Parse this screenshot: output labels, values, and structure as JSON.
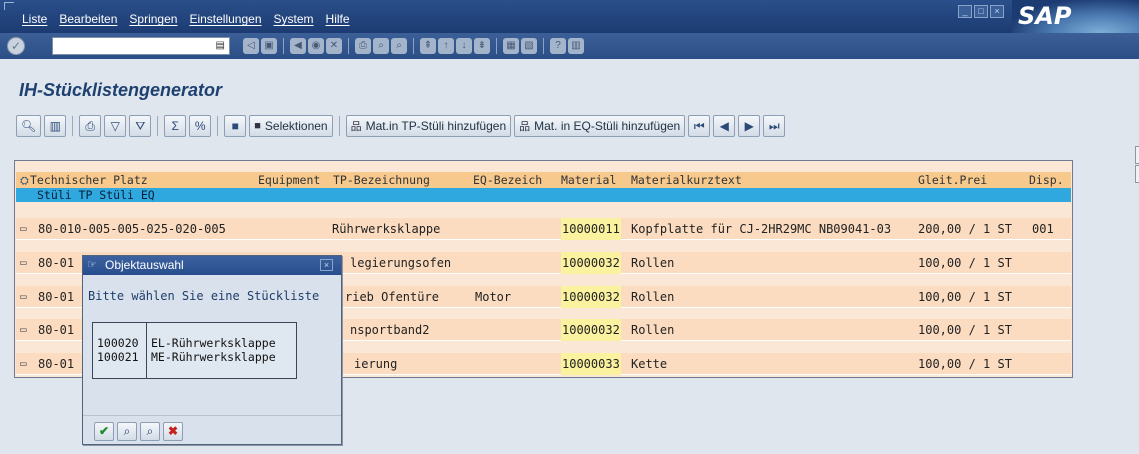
{
  "menu": [
    "Liste",
    "Bearbeiten",
    "Springen",
    "Einstellungen",
    "System",
    "Hilfe"
  ],
  "logo": "SAP",
  "title": "IH-Stücklistengenerator",
  "toolbar": {
    "selektionen": "Selektionen",
    "add_tp": "Mat.in TP-Stüli hinzufügen",
    "add_eq": "Mat. in EQ-Stüli hinzufügen"
  },
  "table": {
    "headers": {
      "tp": "Technischer Platz",
      "equipment": "Equipment",
      "tp_bez": "TP-Bezeichnung",
      "eq_bez": "EQ-Bezeich",
      "material": "Material",
      "kurztext": "Materialkurztext",
      "preis": "Gleit.Prei",
      "disp": "Disp.",
      "sub": "Stüli TP Stüli EQ"
    },
    "rows": [
      {
        "tp": "80-010-005-005-025-020-005",
        "equipment": "",
        "tp_bez": "Rührwerksklappe",
        "eq_bez": "",
        "material": "10000011",
        "kurztext": "Kopfplatte für CJ-2HR29MC NB09041-03",
        "preis": "200,00 / 1 ST",
        "disp": "001"
      },
      {
        "tp": "80-01",
        "equipment": "",
        "tp_bez": "legierungsofen",
        "eq_bez": "",
        "material": "10000032",
        "kurztext": "Rollen",
        "preis": "100,00 / 1 ST",
        "disp": ""
      },
      {
        "tp": "80-01",
        "equipment": "",
        "tp_bez": "rieb Ofentüre",
        "eq_bez": "Motor",
        "material": "10000032",
        "kurztext": "Rollen",
        "preis": "100,00 / 1 ST",
        "disp": ""
      },
      {
        "tp": "80-01",
        "equipment": "",
        "tp_bez": "nsportband2",
        "eq_bez": "",
        "material": "10000032",
        "kurztext": "Rollen",
        "preis": "100,00 / 1 ST",
        "disp": ""
      },
      {
        "tp": "80-01",
        "equipment": "",
        "tp_bez": "ierung",
        "eq_bez": "",
        "material": "10000033",
        "kurztext": "Kette",
        "preis": "100,00 / 1 ST",
        "disp": ""
      }
    ]
  },
  "dialog": {
    "title": "Objektauswahl",
    "prompt": "Bitte wählen Sie eine Stückliste",
    "items": [
      {
        "num": "100020",
        "text": "EL-Rührwerksklappe"
      },
      {
        "num": "100021",
        "text": "ME-Rührwerksklappe"
      }
    ]
  },
  "colors": {
    "menubar": "#1c3b72",
    "header_row": "#f7c98d",
    "subheader_row": "#2fa8e0",
    "data_row": "#fcdcc0",
    "material_highlight": "#fbf2a0"
  }
}
